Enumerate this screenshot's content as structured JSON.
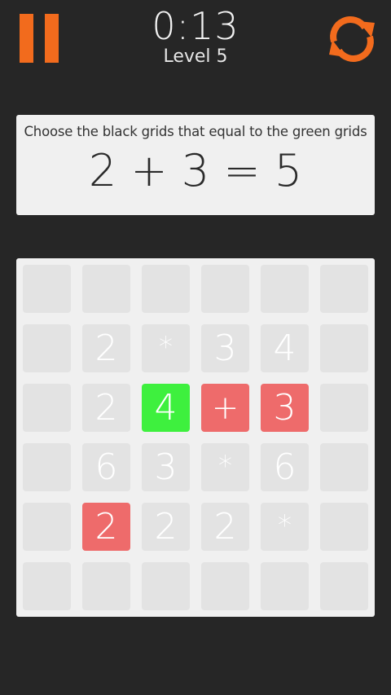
{
  "header": {
    "timer": "0:13",
    "level": "Level 5",
    "pause_icon": "pause-icon",
    "restart_icon": "restart-icon"
  },
  "instruction_card": {
    "text": "Choose the black grids that equal to the green grids",
    "equation": "2 + 3 = 5"
  },
  "board": {
    "rows": [
      [
        {
          "value": "",
          "state": "empty"
        },
        {
          "value": "",
          "state": "empty"
        },
        {
          "value": "",
          "state": "empty"
        },
        {
          "value": "",
          "state": "empty"
        },
        {
          "value": "",
          "state": "empty"
        },
        {
          "value": "",
          "state": "empty"
        }
      ],
      [
        {
          "value": "",
          "state": "empty"
        },
        {
          "value": "2",
          "state": "normal"
        },
        {
          "value": "*",
          "state": "normal"
        },
        {
          "value": "3",
          "state": "normal"
        },
        {
          "value": "4",
          "state": "normal"
        },
        {
          "value": "",
          "state": "empty"
        }
      ],
      [
        {
          "value": "",
          "state": "empty"
        },
        {
          "value": "2",
          "state": "normal"
        },
        {
          "value": "4",
          "state": "green"
        },
        {
          "value": "+",
          "state": "red"
        },
        {
          "value": "3",
          "state": "red"
        },
        {
          "value": "",
          "state": "empty"
        }
      ],
      [
        {
          "value": "",
          "state": "empty"
        },
        {
          "value": "6",
          "state": "normal"
        },
        {
          "value": "3",
          "state": "normal"
        },
        {
          "value": "*",
          "state": "normal"
        },
        {
          "value": "6",
          "state": "normal"
        },
        {
          "value": "",
          "state": "empty"
        }
      ],
      [
        {
          "value": "",
          "state": "empty"
        },
        {
          "value": "2",
          "state": "red"
        },
        {
          "value": "2",
          "state": "normal"
        },
        {
          "value": "2",
          "state": "normal"
        },
        {
          "value": "*",
          "state": "normal"
        },
        {
          "value": "",
          "state": "empty"
        }
      ],
      [
        {
          "value": "",
          "state": "empty"
        },
        {
          "value": "",
          "state": "empty"
        },
        {
          "value": "",
          "state": "empty"
        },
        {
          "value": "",
          "state": "empty"
        },
        {
          "value": "",
          "state": "empty"
        },
        {
          "value": "",
          "state": "empty"
        }
      ]
    ]
  },
  "colors": {
    "background": "#262626",
    "accent_orange": "#F26B1D",
    "panel": "#F0F0F0",
    "cell_default": "#E3E3E3",
    "cell_green": "#3EF03E",
    "cell_red": "#EE6B6B",
    "cell_text": "#FFFFFF"
  }
}
